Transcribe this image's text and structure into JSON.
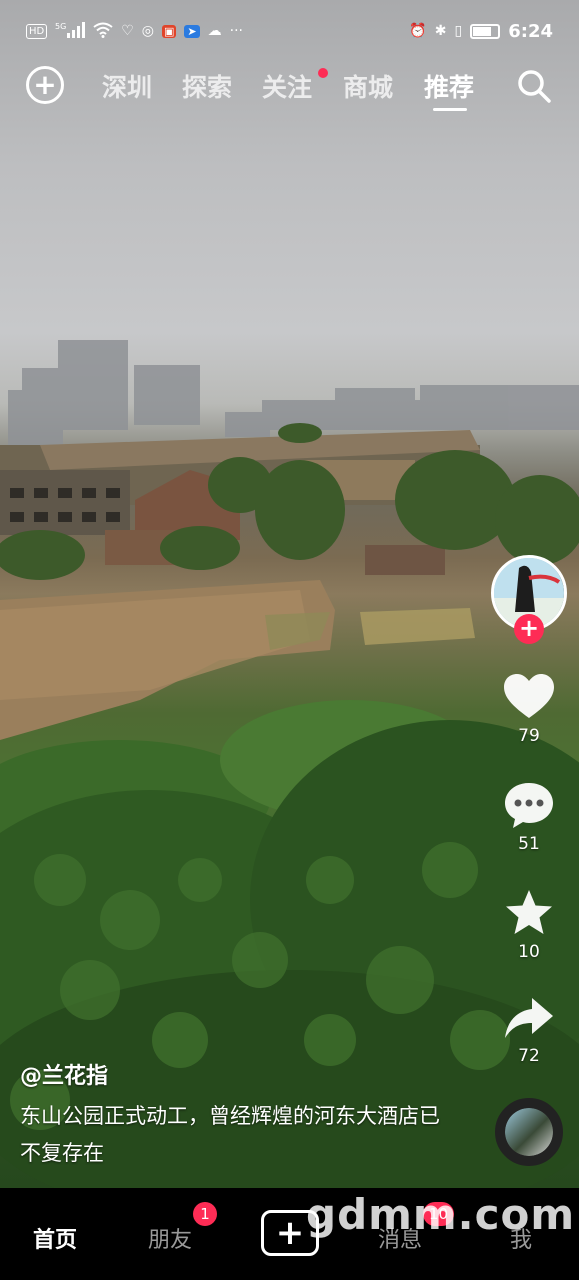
{
  "status_bar": {
    "network": "HD",
    "signal": "5G",
    "time": "6:24"
  },
  "top_nav": {
    "tabs": [
      "深圳",
      "探索",
      "关注",
      "商城",
      "推荐"
    ],
    "active_tab": "推荐"
  },
  "actions": {
    "likes": "79",
    "comments": "51",
    "favorites": "10",
    "shares": "72"
  },
  "caption": {
    "author": "@兰花指",
    "description": "东山公园正式动工，曾经辉煌的河东大酒店已不复存在"
  },
  "bottom_nav": {
    "home": "首页",
    "friends": "朋友",
    "friends_badge": "1",
    "messages": "消息",
    "messages_badge": "10",
    "me": "我",
    "create": "+"
  },
  "watermark": "gdmm.com",
  "colors": {
    "accent": "#fe2c55"
  }
}
